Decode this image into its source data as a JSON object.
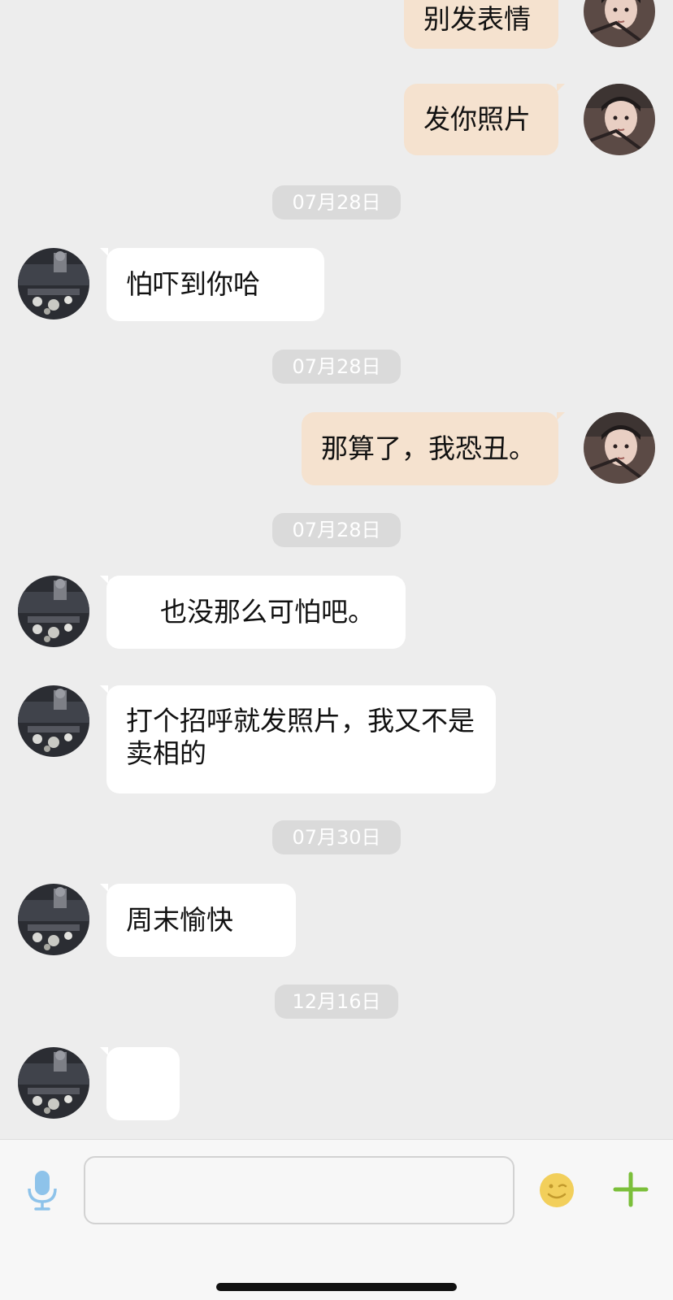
{
  "colors": {
    "background": "#ededed",
    "incoming_bubble": "#ffffff",
    "outgoing_bubble": "#f5e2cf",
    "date_chip": "#dadada",
    "mic_icon": "#8ec3ea",
    "emoji_icon": "#f2cf5b",
    "plus_icon": "#7bbf3a"
  },
  "messages": [
    {
      "direction": "out",
      "text": "别发表情"
    },
    {
      "direction": "out",
      "text": "发你照片"
    },
    {
      "type": "date",
      "text": "07月28日"
    },
    {
      "direction": "in",
      "text": "怕吓到你哈"
    },
    {
      "type": "date",
      "text": "07月28日"
    },
    {
      "direction": "out",
      "text": "那算了，我恐丑。"
    },
    {
      "type": "date",
      "text": "07月28日"
    },
    {
      "direction": "in",
      "text": "也没那么可怕吧。"
    },
    {
      "direction": "in",
      "text": "打个招呼就发照片，我又不是卖相的"
    },
    {
      "type": "date",
      "text": "07月30日"
    },
    {
      "direction": "in",
      "text": "周末愉快"
    },
    {
      "type": "date",
      "text": "12月16日"
    },
    {
      "direction": "in",
      "text": ""
    }
  ],
  "input_bar": {
    "value": "",
    "icons": [
      "microphone-icon",
      "emoji-icon",
      "plus-icon"
    ]
  }
}
